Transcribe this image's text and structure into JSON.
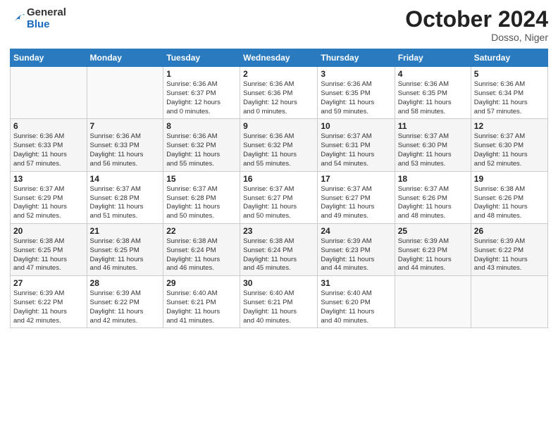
{
  "header": {
    "logo_general": "General",
    "logo_blue": "Blue",
    "month_title": "October 2024",
    "location": "Dosso, Niger"
  },
  "weekdays": [
    "Sunday",
    "Monday",
    "Tuesday",
    "Wednesday",
    "Thursday",
    "Friday",
    "Saturday"
  ],
  "weeks": [
    [
      {
        "day": "",
        "info": ""
      },
      {
        "day": "",
        "info": ""
      },
      {
        "day": "1",
        "info": "Sunrise: 6:36 AM\nSunset: 6:37 PM\nDaylight: 12 hours\nand 0 minutes."
      },
      {
        "day": "2",
        "info": "Sunrise: 6:36 AM\nSunset: 6:36 PM\nDaylight: 12 hours\nand 0 minutes."
      },
      {
        "day": "3",
        "info": "Sunrise: 6:36 AM\nSunset: 6:35 PM\nDaylight: 11 hours\nand 59 minutes."
      },
      {
        "day": "4",
        "info": "Sunrise: 6:36 AM\nSunset: 6:35 PM\nDaylight: 11 hours\nand 58 minutes."
      },
      {
        "day": "5",
        "info": "Sunrise: 6:36 AM\nSunset: 6:34 PM\nDaylight: 11 hours\nand 57 minutes."
      }
    ],
    [
      {
        "day": "6",
        "info": "Sunrise: 6:36 AM\nSunset: 6:33 PM\nDaylight: 11 hours\nand 57 minutes."
      },
      {
        "day": "7",
        "info": "Sunrise: 6:36 AM\nSunset: 6:33 PM\nDaylight: 11 hours\nand 56 minutes."
      },
      {
        "day": "8",
        "info": "Sunrise: 6:36 AM\nSunset: 6:32 PM\nDaylight: 11 hours\nand 55 minutes."
      },
      {
        "day": "9",
        "info": "Sunrise: 6:36 AM\nSunset: 6:32 PM\nDaylight: 11 hours\nand 55 minutes."
      },
      {
        "day": "10",
        "info": "Sunrise: 6:37 AM\nSunset: 6:31 PM\nDaylight: 11 hours\nand 54 minutes."
      },
      {
        "day": "11",
        "info": "Sunrise: 6:37 AM\nSunset: 6:30 PM\nDaylight: 11 hours\nand 53 minutes."
      },
      {
        "day": "12",
        "info": "Sunrise: 6:37 AM\nSunset: 6:30 PM\nDaylight: 11 hours\nand 52 minutes."
      }
    ],
    [
      {
        "day": "13",
        "info": "Sunrise: 6:37 AM\nSunset: 6:29 PM\nDaylight: 11 hours\nand 52 minutes."
      },
      {
        "day": "14",
        "info": "Sunrise: 6:37 AM\nSunset: 6:28 PM\nDaylight: 11 hours\nand 51 minutes."
      },
      {
        "day": "15",
        "info": "Sunrise: 6:37 AM\nSunset: 6:28 PM\nDaylight: 11 hours\nand 50 minutes."
      },
      {
        "day": "16",
        "info": "Sunrise: 6:37 AM\nSunset: 6:27 PM\nDaylight: 11 hours\nand 50 minutes."
      },
      {
        "day": "17",
        "info": "Sunrise: 6:37 AM\nSunset: 6:27 PM\nDaylight: 11 hours\nand 49 minutes."
      },
      {
        "day": "18",
        "info": "Sunrise: 6:37 AM\nSunset: 6:26 PM\nDaylight: 11 hours\nand 48 minutes."
      },
      {
        "day": "19",
        "info": "Sunrise: 6:38 AM\nSunset: 6:26 PM\nDaylight: 11 hours\nand 48 minutes."
      }
    ],
    [
      {
        "day": "20",
        "info": "Sunrise: 6:38 AM\nSunset: 6:25 PM\nDaylight: 11 hours\nand 47 minutes."
      },
      {
        "day": "21",
        "info": "Sunrise: 6:38 AM\nSunset: 6:25 PM\nDaylight: 11 hours\nand 46 minutes."
      },
      {
        "day": "22",
        "info": "Sunrise: 6:38 AM\nSunset: 6:24 PM\nDaylight: 11 hours\nand 46 minutes."
      },
      {
        "day": "23",
        "info": "Sunrise: 6:38 AM\nSunset: 6:24 PM\nDaylight: 11 hours\nand 45 minutes."
      },
      {
        "day": "24",
        "info": "Sunrise: 6:39 AM\nSunset: 6:23 PM\nDaylight: 11 hours\nand 44 minutes."
      },
      {
        "day": "25",
        "info": "Sunrise: 6:39 AM\nSunset: 6:23 PM\nDaylight: 11 hours\nand 44 minutes."
      },
      {
        "day": "26",
        "info": "Sunrise: 6:39 AM\nSunset: 6:22 PM\nDaylight: 11 hours\nand 43 minutes."
      }
    ],
    [
      {
        "day": "27",
        "info": "Sunrise: 6:39 AM\nSunset: 6:22 PM\nDaylight: 11 hours\nand 42 minutes."
      },
      {
        "day": "28",
        "info": "Sunrise: 6:39 AM\nSunset: 6:22 PM\nDaylight: 11 hours\nand 42 minutes."
      },
      {
        "day": "29",
        "info": "Sunrise: 6:40 AM\nSunset: 6:21 PM\nDaylight: 11 hours\nand 41 minutes."
      },
      {
        "day": "30",
        "info": "Sunrise: 6:40 AM\nSunset: 6:21 PM\nDaylight: 11 hours\nand 40 minutes."
      },
      {
        "day": "31",
        "info": "Sunrise: 6:40 AM\nSunset: 6:20 PM\nDaylight: 11 hours\nand 40 minutes."
      },
      {
        "day": "",
        "info": ""
      },
      {
        "day": "",
        "info": ""
      }
    ]
  ]
}
